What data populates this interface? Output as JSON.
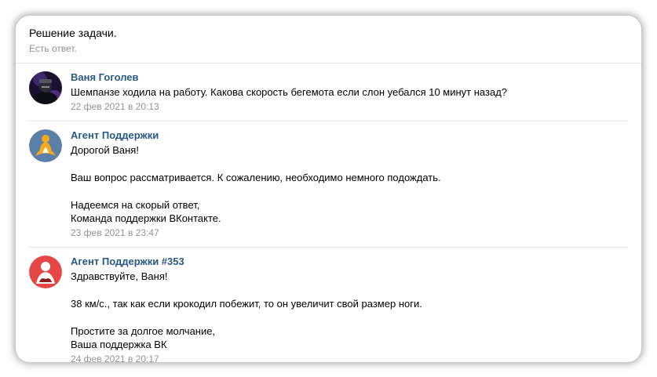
{
  "ticket": {
    "title": "Решение задачи.",
    "status": "Есть ответ."
  },
  "messages": [
    {
      "author": "Ваня Гоголев",
      "avatar_icon": "user-photo-icon",
      "lines": [
        "Шемпанзе ходила на работу. Какова скорость бегемота если слон уебался 10 минут назад?"
      ],
      "date": "22 фев 2021 в 20:13"
    },
    {
      "author": "Агент Поддержки",
      "avatar_icon": "support-agent-icon",
      "avatar_color": "#5b80a8",
      "lines": [
        "Дорогой Ваня!",
        "",
        "Ваш вопрос рассматривается. К сожалению, необходимо немного подождать.",
        "",
        "Надеемся на скорый ответ,",
        "Команда поддержки ВКонтакте."
      ],
      "date": "23 фев 2021 в 23:47"
    },
    {
      "author": "Агент Поддержки #353",
      "avatar_icon": "support-agent-icon",
      "avatar_color": "#e64646",
      "lines": [
        "Здравствуйте, Ваня!",
        "",
        "38 км/с., так как если крокодил побежит, то он увеличит свой размер ноги.",
        "",
        "Простите за долгое молчание,",
        "Ваша поддержка ВК"
      ],
      "date": "24 фев 2021 в 20:17"
    }
  ]
}
